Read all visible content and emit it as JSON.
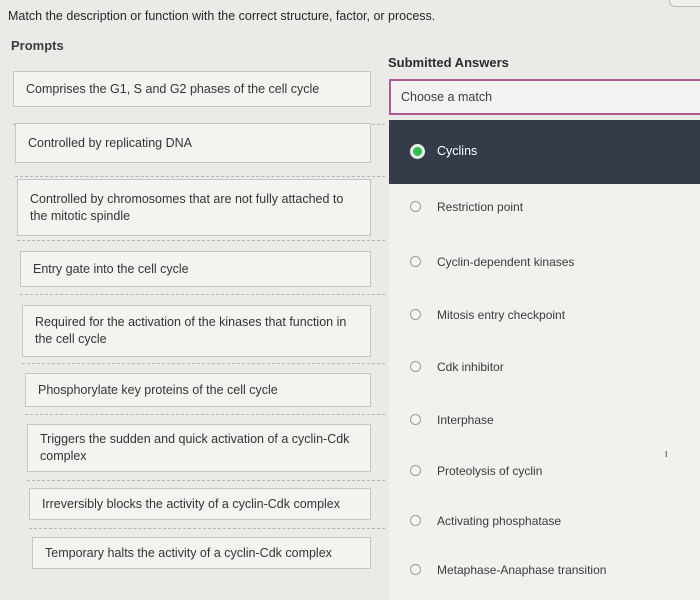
{
  "instructions": "Match the description or function with the correct structure, factor, or process.",
  "prompts_title": "Prompts",
  "answers_title": "Submitted Answers",
  "prompts": [
    "Comprises the G1, S and G2 phases of the cell cycle",
    "Controlled by replicating DNA",
    "Controlled by chromosomes that are not fully attached to the mitotic spindle",
    "Entry gate into the cell cycle",
    "Required for the activation of the kinases that function in the cell cycle",
    "Phosphorylate key proteins of the cell cycle",
    "Triggers the sudden and quick activation of a cyclin-Cdk complex",
    "Irreversibly blocks the activity of a cyclin-Cdk complex",
    "Temporary halts the activity of a cyclin-Cdk complex"
  ],
  "select_placeholder": "Choose a match",
  "options": [
    "Cyclins",
    "Restriction point",
    "Cyclin-dependent kinases",
    "Mitosis entry checkpoint",
    "Cdk inhibitor",
    "Interphase",
    "Proteolysis of cyclin",
    "Activating phosphatase",
    "Metaphase-Anaphase transition"
  ],
  "selected_option": "Cyclins",
  "stray_mark": "ι"
}
